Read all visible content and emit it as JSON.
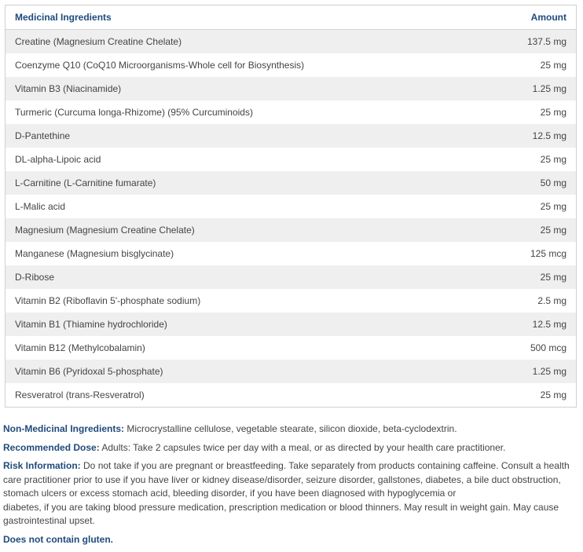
{
  "table": {
    "headers": {
      "ingredient": "Medicinal Ingredients",
      "amount": "Amount"
    },
    "rows": [
      {
        "ingredient": "Creatine (Magnesium Creatine Chelate)",
        "amount": "137.5 mg"
      },
      {
        "ingredient": "Coenzyme Q10 (CoQ10 Microorganisms-Whole cell for Biosynthesis)",
        "amount": "25 mg"
      },
      {
        "ingredient": "Vitamin B3 (Niacinamide)",
        "amount": "1.25 mg"
      },
      {
        "ingredient": "Turmeric (Curcuma longa-Rhizome) (95% Curcuminoids)",
        "amount": "25 mg"
      },
      {
        "ingredient": "D-Pantethine",
        "amount": "12.5 mg"
      },
      {
        "ingredient": "DL-alpha-Lipoic acid",
        "amount": "25 mg"
      },
      {
        "ingredient": "L-Carnitine (L-Carnitine fumarate)",
        "amount": "50 mg"
      },
      {
        "ingredient": "L-Malic acid",
        "amount": "25 mg"
      },
      {
        "ingredient": "Magnesium (Magnesium Creatine Chelate)",
        "amount": "25 mg"
      },
      {
        "ingredient": "Manganese (Magnesium bisglycinate)",
        "amount": "125 mcg"
      },
      {
        "ingredient": "D-Ribose",
        "amount": "25 mg"
      },
      {
        "ingredient": "Vitamin B2 (Riboflavin 5'-phosphate sodium)",
        "amount": "2.5 mg"
      },
      {
        "ingredient": "Vitamin B1 (Thiamine hydrochloride)",
        "amount": "12.5 mg"
      },
      {
        "ingredient": "Vitamin B12 (Methylcobalamin)",
        "amount": "500 mcg"
      },
      {
        "ingredient": "Vitamin B6 (Pyridoxal 5-phosphate)",
        "amount": "1.25 mg"
      },
      {
        "ingredient": "Resveratrol (trans-Resveratrol)",
        "amount": "25 mg"
      }
    ]
  },
  "notes": {
    "non_medicinal_label": "Non-Medicinal Ingredients:",
    "non_medicinal_text": "Microcrystalline cellulose, vegetable stearate, silicon dioxide, beta-cyclodextrin.",
    "dose_label": "Recommended Dose:",
    "dose_text": "Adults: Take 2 capsules twice per day with a meal, or as directed by your health care practitioner.",
    "risk_label": "Risk Information:",
    "risk_text_1": "Do not take if you are pregnant or breastfeeding. Take separately from products containing caffeine. Consult a health care practitioner prior to use if you have liver or kidney disease/disorder, seizure disorder, gallstones, diabetes, a bile duct obstruction, stomach ulcers or excess stomach acid, bleeding disorder, if you have been diagnosed with hypoglycemia or",
    "risk_text_2": "diabetes, if you are taking blood pressure medication, prescription medication or blood thinners. May result in weight gain. May cause gastrointestinal upset.",
    "gluten": "Does not contain gluten."
  },
  "colors": {
    "heading": "#1f4a7c",
    "row_stripe": "#efefef",
    "text": "#444444"
  }
}
